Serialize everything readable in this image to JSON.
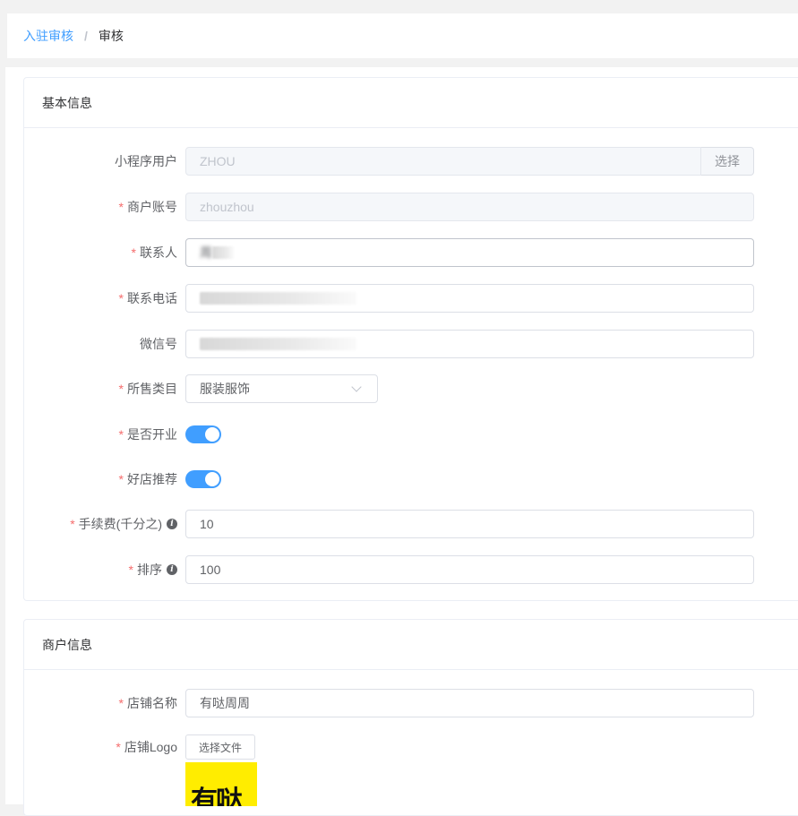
{
  "breadcrumb": {
    "parent": "入驻审核",
    "separator": "/",
    "current": "审核"
  },
  "basic_info": {
    "title": "基本信息",
    "mini_program_user": {
      "label": "小程序用户",
      "value": "ZHOU",
      "button": "选择"
    },
    "merchant_account": {
      "label": "商户账号",
      "value": "zhouzhou"
    },
    "contact": {
      "label": "联系人",
      "value": "周"
    },
    "phone": {
      "label": "联系电话"
    },
    "wechat": {
      "label": "微信号"
    },
    "category": {
      "label": "所售类目",
      "value": "服装服饰"
    },
    "is_open": {
      "label": "是否开业",
      "on": true
    },
    "recommended": {
      "label": "好店推荐",
      "on": true
    },
    "fee": {
      "label": "手续费(千分之)",
      "value": "10"
    },
    "sort": {
      "label": "排序",
      "value": "100"
    }
  },
  "merchant_info": {
    "title": "商户信息",
    "shop_name": {
      "label": "店铺名称",
      "value": "有哒周周"
    },
    "shop_logo": {
      "label": "店铺Logo",
      "button": "选择文件",
      "logo_text": "有哒"
    }
  },
  "required_mark": "*",
  "info_mark": "i",
  "colors": {
    "primary": "#409eff",
    "required": "#f56c6c",
    "logo_bg": "#ffed00"
  }
}
